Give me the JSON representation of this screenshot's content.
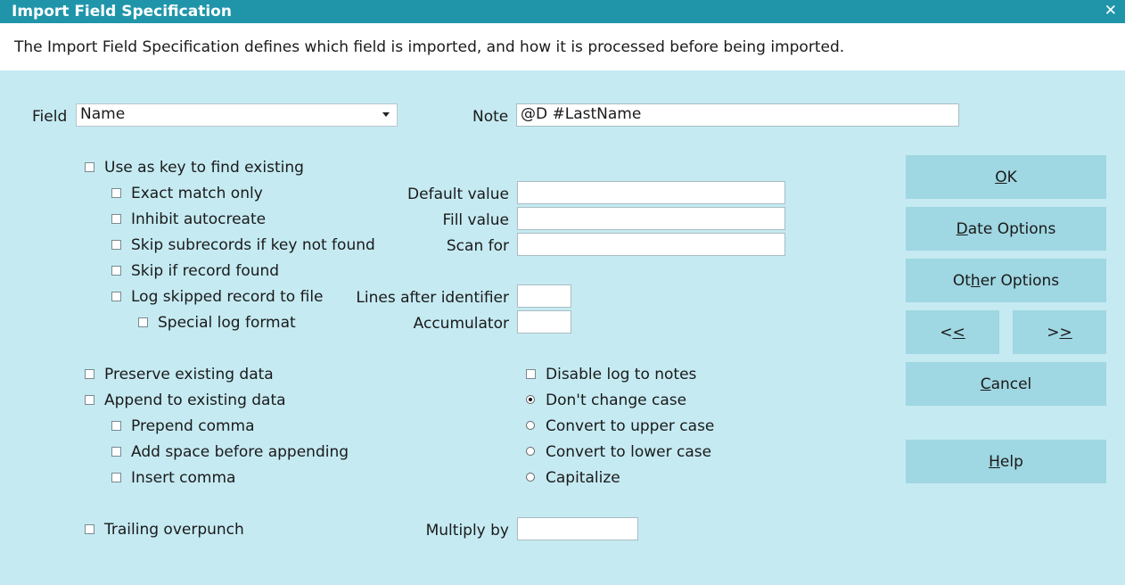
{
  "window": {
    "title": "Import Field Specification",
    "close_glyph": "✕"
  },
  "description": "The Import Field Specification defines which field is imported, and how it is processed before being imported.",
  "field": {
    "label": "Field",
    "value": "Name"
  },
  "note": {
    "label": "Note",
    "value": "@D #LastName"
  },
  "key_options": {
    "use_as_key": {
      "label": "Use as key to find existing",
      "checked": false
    },
    "exact_match": {
      "label": "Exact match only",
      "checked": false
    },
    "inhibit_autocreate": {
      "label": "Inhibit autocreate",
      "checked": false
    },
    "skip_subrecords": {
      "label": "Skip subrecords if key not found",
      "checked": false
    },
    "skip_if_found": {
      "label": "Skip if record found",
      "checked": false
    },
    "log_skipped": {
      "label": "Log skipped record to file",
      "checked": false
    },
    "special_log": {
      "label": "Special log format",
      "checked": false
    }
  },
  "values": {
    "default_value": {
      "label": "Default value",
      "value": ""
    },
    "fill_value": {
      "label": "Fill value",
      "value": ""
    },
    "scan_for": {
      "label": "Scan for",
      "value": ""
    },
    "lines_after": {
      "label": "Lines after identifier",
      "value": ""
    },
    "accumulator": {
      "label": "Accumulator",
      "value": ""
    },
    "multiply_by": {
      "label": "Multiply by",
      "value": ""
    }
  },
  "data_options": {
    "preserve": {
      "label": "Preserve existing data",
      "checked": false
    },
    "append": {
      "label": "Append to existing data",
      "checked": false
    },
    "prepend_comma": {
      "label": "Prepend comma",
      "checked": false
    },
    "add_space": {
      "label": "Add space before appending",
      "checked": false
    },
    "insert_comma": {
      "label": "Insert comma",
      "checked": false
    },
    "trailing_overpunch": {
      "label": "Trailing overpunch",
      "checked": false
    }
  },
  "case_options": {
    "disable_log": {
      "label": "Disable log to notes",
      "checked": false
    },
    "selected": "dont_change",
    "dont_change": {
      "label": "Don't change case"
    },
    "upper": {
      "label": "Convert to upper case"
    },
    "lower": {
      "label": "Convert to lower case"
    },
    "capitalize": {
      "label": "Capitalize"
    }
  },
  "buttons": {
    "ok": {
      "pre": "",
      "u": "O",
      "post": "K"
    },
    "date_options": {
      "pre": "",
      "u": "D",
      "post": "ate Options"
    },
    "other_options": {
      "pre": "Ot",
      "u": "h",
      "post": "er Options"
    },
    "prev": {
      "pre": "<",
      "u": "<",
      "post": ""
    },
    "next": {
      "pre": ">",
      "u": ">",
      "post": ""
    },
    "cancel": {
      "pre": "",
      "u": "C",
      "post": "ancel"
    },
    "help": {
      "pre": "",
      "u": "H",
      "post": "elp"
    }
  }
}
